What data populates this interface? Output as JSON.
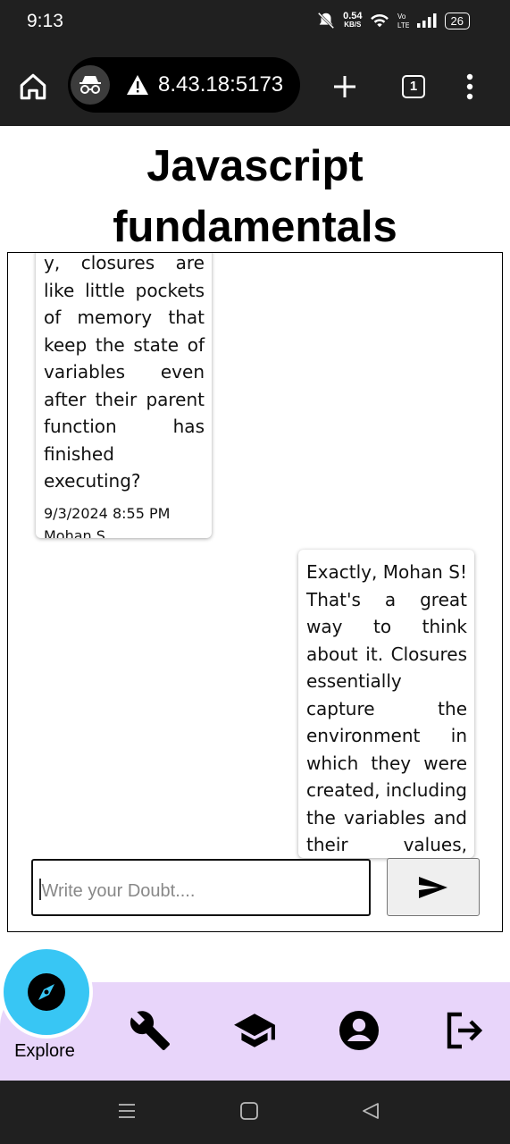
{
  "status_bar": {
    "time": "9:13",
    "net_speed_value": "0.54",
    "net_speed_unit": "KB/S",
    "battery": "26"
  },
  "browser": {
    "url": "8.43.18:5173",
    "tab_count": "1",
    "icons": [
      "home-icon",
      "incognito-icon",
      "warning-icon",
      "plus-icon",
      "tab-switcher-icon",
      "menu-dots-icon"
    ]
  },
  "page": {
    "title_line1": "Javascript",
    "title_line2": "fundamentals"
  },
  "messages": [
    {
      "text": "y, closures are like little pockets of memory that keep the state of variables even after their parent function has finished executing?",
      "timestamp": "9/3/2024 8:55 PM",
      "author": "Mohan S",
      "side": "left"
    },
    {
      "text": "Exactly, Mohan S! That's a great way to think about it. Closures essentially capture the environment in which they were created, including the variables and their values, allowing inner functi",
      "side": "right"
    }
  ],
  "composer": {
    "placeholder": "Write your Doubt....",
    "send_icon": "send-icon"
  },
  "bottom_nav": {
    "explore_label": "Explore",
    "explore_color": "#38c6f4",
    "bar_color": "#e8d5fa",
    "items": [
      "tools-icon",
      "graduation-cap-icon",
      "account-icon",
      "logout-icon"
    ]
  }
}
